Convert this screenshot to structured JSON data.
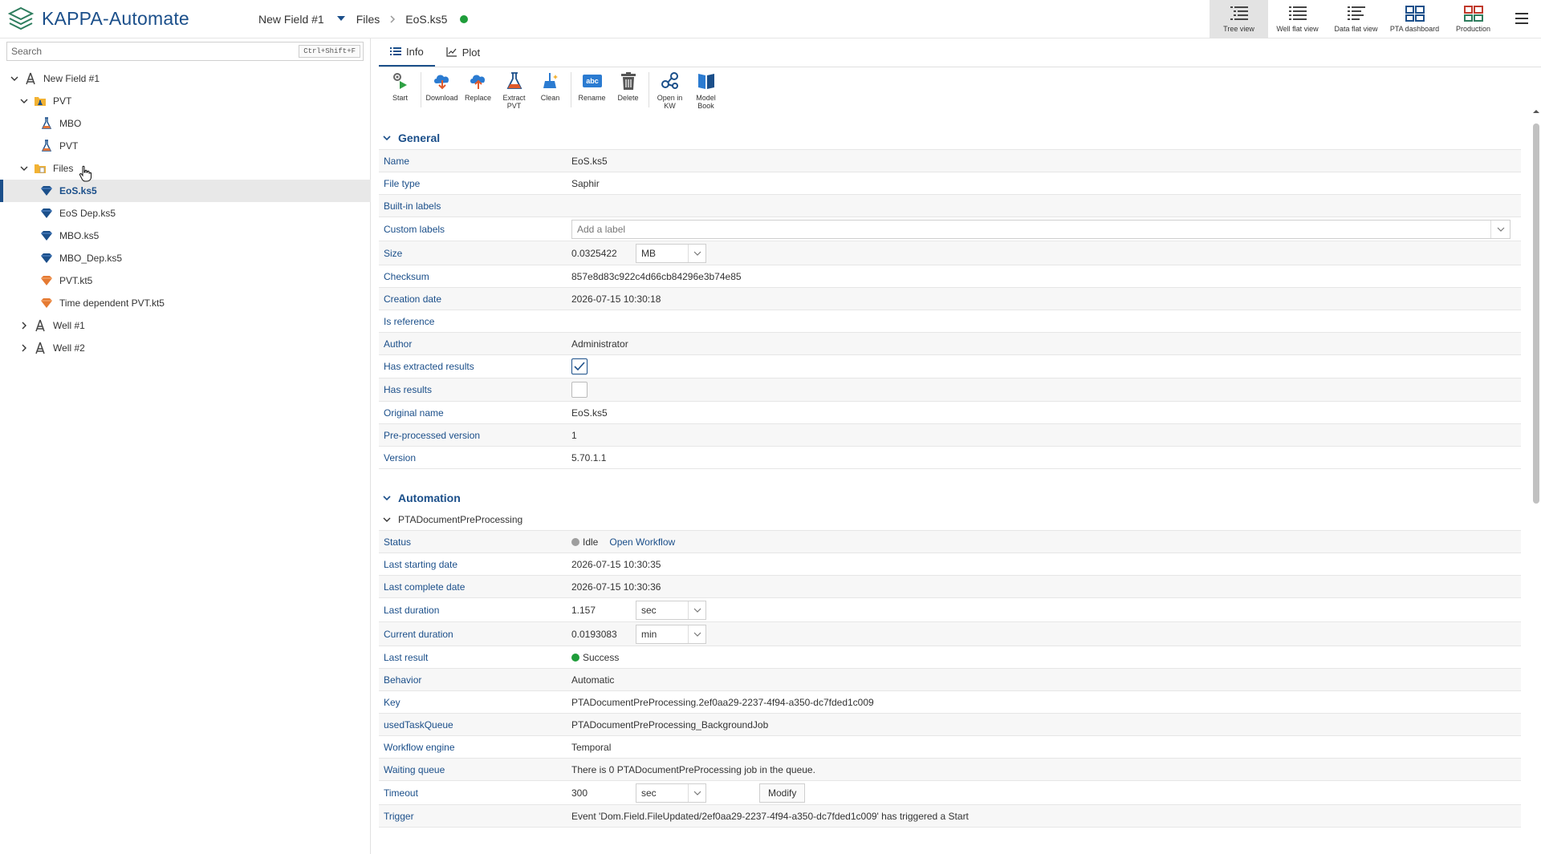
{
  "app": {
    "title": "KAPPA-Automate"
  },
  "breadcrumb": {
    "field": "New Field #1",
    "folder": "Files",
    "file": "EoS.ks5",
    "status_color": "#1f9d3a"
  },
  "views": [
    {
      "label": "Tree view",
      "icon": "tree-view-icon"
    },
    {
      "label": "Well flat view",
      "icon": "well-flat-view-icon"
    },
    {
      "label": "Data flat view",
      "icon": "data-flat-view-icon"
    },
    {
      "label": "PTA dashboard",
      "icon": "pta-dashboard-icon"
    },
    {
      "label": "Production",
      "icon": "production-icon"
    }
  ],
  "search": {
    "placeholder": "Search",
    "shortcut": "Ctrl+Shift+F"
  },
  "tree": {
    "root": "New Field #1",
    "pvt_folder": "PVT",
    "mbo": "MBO",
    "pvt": "PVT",
    "files_folder": "Files",
    "files": [
      "EoS.ks5",
      "EoS Dep.ks5",
      "MBO.ks5",
      "MBO_Dep.ks5",
      "PVT.kt5",
      "Time dependent PVT.kt5"
    ],
    "well1": "Well #1",
    "well2": "Well #2"
  },
  "tabs": {
    "info": "Info",
    "plot": "Plot"
  },
  "toolbar": {
    "start": "Start",
    "download": "Download",
    "replace": "Replace",
    "extract1": "Extract",
    "extract2": "PVT",
    "clean": "Clean",
    "rename": "Rename",
    "delete": "Delete",
    "openkw1": "Open in",
    "openkw2": "KW",
    "model1": "Model",
    "model2": "Book"
  },
  "general": {
    "title": "General",
    "name_label": "Name",
    "name": "EoS.ks5",
    "filetype_label": "File type",
    "filetype": "Saphir",
    "builtin_label": "Built-in labels",
    "custom_label": "Custom labels",
    "custom_placeholder": "Add a label",
    "size_label": "Size",
    "size": "0.0325422",
    "size_unit": "MB",
    "checksum_label": "Checksum",
    "checksum": "857e8d83c922c4d66cb84296e3b74e85",
    "creation_label": "Creation date",
    "creation": "2026-07-15 10:30:18",
    "isref_label": "Is reference",
    "author_label": "Author",
    "author": "Administrator",
    "extracted_label": "Has extracted results",
    "extracted_checked": true,
    "results_label": "Has results",
    "results_checked": false,
    "orig_label": "Original name",
    "orig": "EoS.ks5",
    "preproc_label": "Pre-processed version",
    "preproc": "1",
    "version_label": "Version",
    "version": "5.70.1.1"
  },
  "automation": {
    "title": "Automation",
    "workflow": "PTADocumentPreProcessing",
    "status_label": "Status",
    "status": "Idle",
    "status_color": "#9e9e9e",
    "open_workflow": "Open Workflow",
    "last_start_label": "Last starting date",
    "last_start": "2026-07-15 10:30:35",
    "last_complete_label": "Last complete date",
    "last_complete": "2026-07-15 10:30:36",
    "last_duration_label": "Last duration",
    "last_duration": "1.157",
    "last_duration_unit": "sec",
    "current_duration_label": "Current duration",
    "current_duration": "0.0193083",
    "current_duration_unit": "min",
    "last_result_label": "Last result",
    "last_result": "Success",
    "last_result_color": "#1f9d3a",
    "behavior_label": "Behavior",
    "behavior": "Automatic",
    "key_label": "Key",
    "key": "PTADocumentPreProcessing.2ef0aa29-2237-4f94-a350-dc7fded1c009",
    "queue_label": "usedTaskQueue",
    "queue": "PTADocumentPreProcessing_BackgroundJob",
    "engine_label": "Workflow engine",
    "engine": "Temporal",
    "waiting_label": "Waiting queue",
    "waiting": "There is 0 PTADocumentPreProcessing job in the queue.",
    "timeout_label": "Timeout",
    "timeout": "300",
    "timeout_unit": "sec",
    "modify": "Modify",
    "trigger_label": "Trigger",
    "trigger": "Event 'Dom.Field.FileUpdated/2ef0aa29-2237-4f94-a350-dc7fded1c009' has triggered a Start"
  },
  "colors": {
    "accent": "#1b4f8a",
    "success": "#1f9d3a"
  }
}
